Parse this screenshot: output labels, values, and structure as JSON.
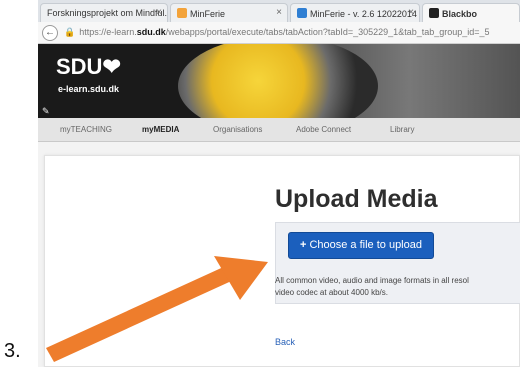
{
  "step_number": "3.",
  "browser": {
    "tabs": [
      {
        "label": "Forskningsprojekt om Mindful..."
      },
      {
        "label": "MinFerie"
      },
      {
        "label": "MinFerie - v. 2.6 12022014"
      },
      {
        "label": "Blackbo"
      }
    ],
    "url_prefix": "https://e-learn.",
    "url_domain": "sdu.dk",
    "url_suffix": "/webapps/portal/execute/tabs/tabAction?tabId=_305229_1&tab_tab_group_id=_5"
  },
  "banner": {
    "logo": "SDU❤",
    "subtitle": "e-learn.sdu.dk"
  },
  "nav": {
    "items": [
      {
        "label": "myTEACHING"
      },
      {
        "label": "myMEDIA"
      },
      {
        "label": "Organisations"
      },
      {
        "label": "Adobe Connect"
      },
      {
        "label": "Library"
      }
    ]
  },
  "main": {
    "title": "Upload Media",
    "choose_button": "Choose a file to upload",
    "info_line1": "All common video, audio and image formats in all resol",
    "info_line2": "video codec at about 4000 kb/s.",
    "back_link": "Back"
  },
  "colors": {
    "arrow": "#ee7d2c",
    "button": "#1b5fbd",
    "link": "#2a62b8"
  }
}
